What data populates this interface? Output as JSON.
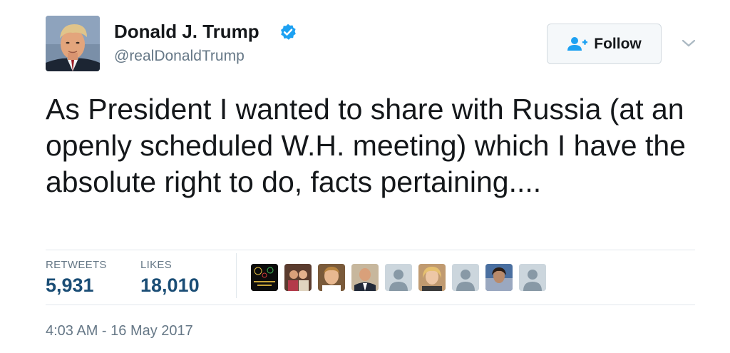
{
  "user": {
    "display_name": "Donald J. Trump",
    "handle": "@realDonaldTrump",
    "verified": true,
    "avatar_icon": "profile-photo"
  },
  "follow_button": {
    "label": "Follow",
    "icon": "add-user-icon"
  },
  "more_menu_icon": "chevron-down-icon",
  "tweet": {
    "text": "As President I wanted to share with Russia (at an openly scheduled W.H. meeting) which I have the absolute right to do, facts pertaining...."
  },
  "stats": {
    "retweets_label": "RETWEETS",
    "retweets_value": "5,931",
    "likes_label": "LIKES",
    "likes_value": "18,010"
  },
  "likers": [
    {
      "kind": "photo",
      "name": "liker-avatar-1",
      "caption": "HAPPY NEW YEAR 2017"
    },
    {
      "kind": "photo",
      "name": "liker-avatar-2"
    },
    {
      "kind": "photo",
      "name": "liker-avatar-3"
    },
    {
      "kind": "photo",
      "name": "liker-avatar-4"
    },
    {
      "kind": "default",
      "name": "liker-avatar-5"
    },
    {
      "kind": "photo",
      "name": "liker-avatar-6"
    },
    {
      "kind": "default",
      "name": "liker-avatar-7"
    },
    {
      "kind": "photo",
      "name": "liker-avatar-8"
    },
    {
      "kind": "default",
      "name": "liker-avatar-9"
    }
  ],
  "timestamp": "4:03 AM - 16 May 2017",
  "colors": {
    "verified_blue": "#1da1f2",
    "stat_value": "#1a4d75",
    "secondary_text": "#657786"
  }
}
